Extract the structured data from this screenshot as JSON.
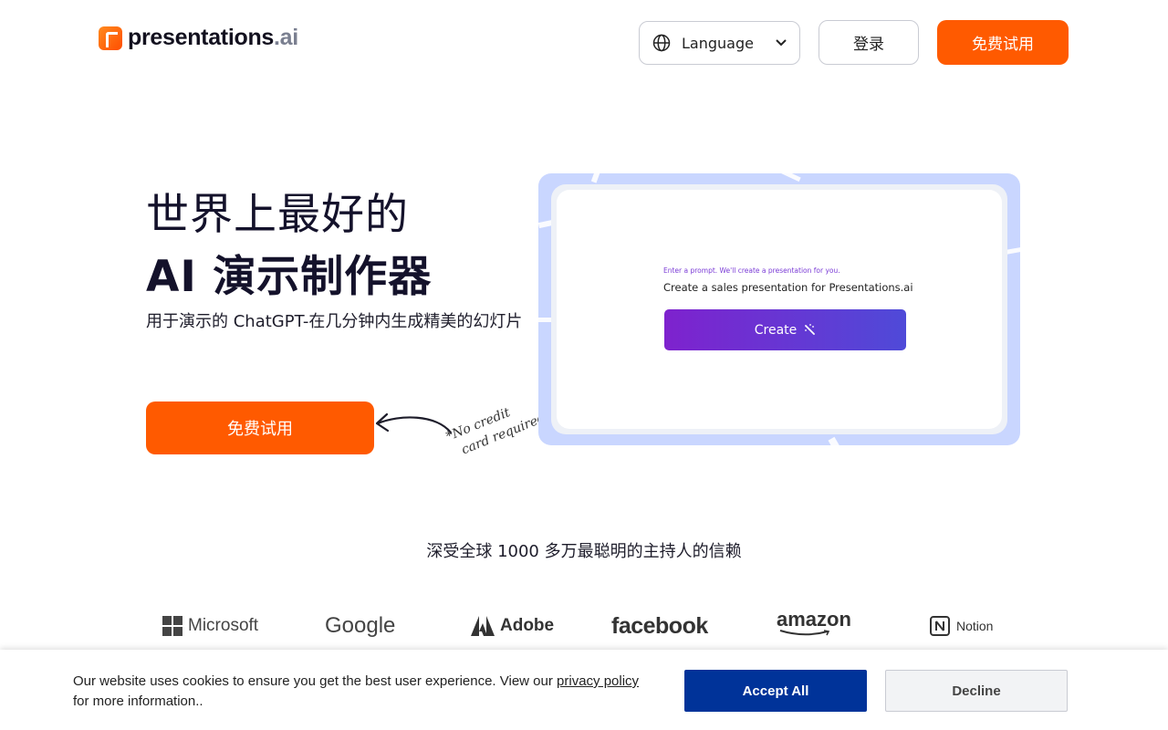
{
  "header": {
    "logo_text": "presentations",
    "logo_suffix": ".ai",
    "language_label": "Language",
    "login_label": "登录",
    "trial_label": "免费试用"
  },
  "hero": {
    "title_line1": "世界上最好的",
    "title_line2": "AI 演示制作器",
    "subtitle": "用于演示的 ChatGPT-在几分钟内生成精美的幻灯片",
    "cta_label": "免费试用",
    "note_line1": "*No credit",
    "note_line2": "card required"
  },
  "preview": {
    "prompt_hint": "Enter a prompt. We'll create a presentation for you.",
    "prompt_text": "Create a sales presentation for Presentations.ai",
    "create_label": "Create"
  },
  "trust": {
    "text": "深受全球 1000 多万最聪明的主持人的信赖"
  },
  "logos": {
    "microsoft": "Microsoft",
    "google": "Google",
    "adobe": "Adobe",
    "facebook": "facebook",
    "amazon": "amazon",
    "notion": "Notion"
  },
  "cookie": {
    "text_before": "Our website uses cookies to ensure you get the best user experience. View our ",
    "link_label": "privacy policy",
    "text_after": " for more information..",
    "accept_label": "Accept All",
    "decline_label": "Decline"
  },
  "colors": {
    "brand_orange": "#ff5a00",
    "accept_blue": "#003399",
    "preview_bg": "#c9d6ff",
    "create_gradient_start": "#7e22ce",
    "create_gradient_end": "#4f4ad8"
  }
}
